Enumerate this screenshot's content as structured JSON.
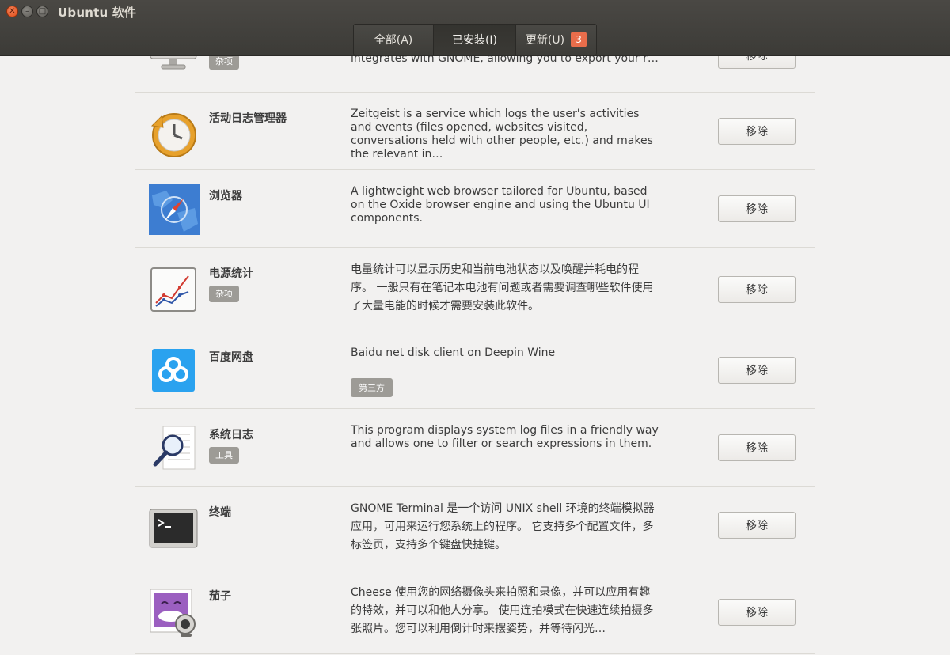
{
  "window": {
    "title": "Ubuntu 软件"
  },
  "tabs": [
    {
      "label": "全部(A)"
    },
    {
      "label": "已安装(I)"
    },
    {
      "label": "更新(U)",
      "badge": "3"
    }
  ],
  "colors": {
    "header": "#3c3b37",
    "badge": "#e96d4b",
    "tag": "#9d9b96",
    "background": "#f2f1f0"
  },
  "apps": [
    {
      "name": "",
      "tag": "杂项",
      "icon": "monitor-icon",
      "description": "integrates with GNOME, allowing you to export your r…",
      "remove_label": "移除"
    },
    {
      "name": "活动日志管理器",
      "tag": "",
      "icon": "history-clock-icon",
      "description": "Zeitgeist is a service which logs the user's activities and events (files opened, websites visited, conversations held with other people, etc.) and makes the relevant in…",
      "remove_label": "移除"
    },
    {
      "name": "浏览器",
      "tag": "",
      "icon": "browser-compass-icon",
      "description": "A lightweight web browser tailored for Ubuntu, based on the Oxide browser engine and using the Ubuntu UI components.",
      "remove_label": "移除"
    },
    {
      "name": "电源统计",
      "tag": "杂项",
      "icon": "power-statistics-icon",
      "description": "电量统计可以显示历史和当前电池状态以及唤醒并耗电的程序。 一般只有在笔记本电池有问题或者需要调查哪些软件使用了大量电能的时候才需要安装此软件。",
      "remove_label": "移除"
    },
    {
      "name": "百度网盘",
      "tag": "",
      "icon": "baidu-cloud-icon",
      "description": "Baidu net disk client on Deepin Wine",
      "third_party": "第三方",
      "remove_label": "移除"
    },
    {
      "name": "系统日志",
      "tag": "工具",
      "icon": "log-magnifier-icon",
      "description": "This program displays system log files in a friendly way and allows one to filter or search expressions in them.",
      "remove_label": "移除"
    },
    {
      "name": "终端",
      "tag": "",
      "icon": "terminal-icon",
      "description": "GNOME Terminal 是一个访问 UNIX shell 环境的终端模拟器应用，可用来运行您系统上的程序。 它支持多个配置文件，多标签页，支持多个键盘快捷键。",
      "remove_label": "移除"
    },
    {
      "name": "茄子",
      "tag": "",
      "icon": "cheese-webcam-icon",
      "description": "Cheese 使用您的网络摄像头来拍照和录像，并可以应用有趣的特效，并可以和他人分享。 使用连拍模式在快速连续拍摄多张照片。您可以利用倒计时来摆姿势，并等待闪光…",
      "remove_label": "移除"
    }
  ]
}
